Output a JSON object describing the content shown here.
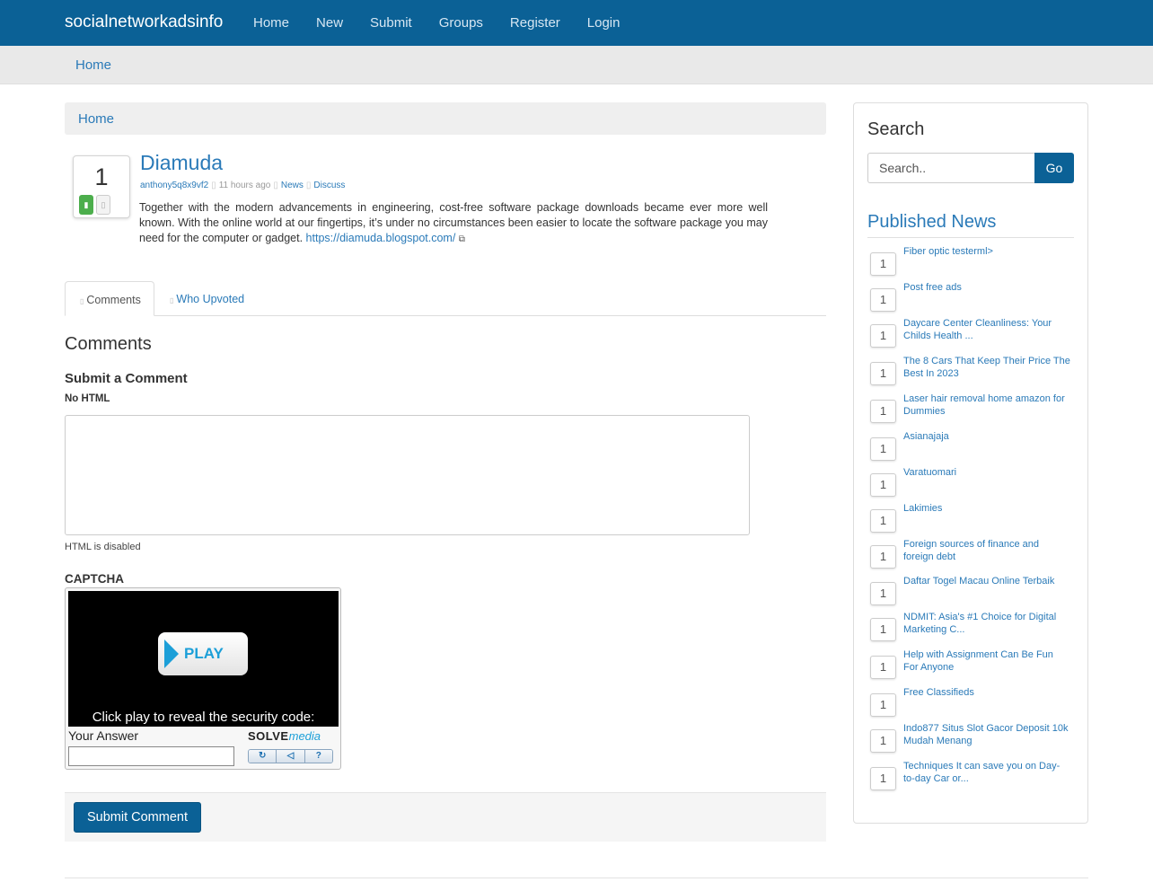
{
  "nav": {
    "brand": "socialnetworkadsinfo",
    "links": [
      "Home",
      "New",
      "Submit",
      "Groups",
      "Register",
      "Login"
    ]
  },
  "subbar": {
    "home": "Home"
  },
  "breadcrumb": {
    "home": "Home"
  },
  "post": {
    "votes": "1",
    "title": "Diamuda",
    "author": "anthony5q8x9vf2",
    "time": "11 hours ago",
    "category": "News",
    "discuss": "Discuss",
    "body": "Together with the modern advancements in engineering, cost-free software package downloads became ever more well known. With the online world at our fingertips, it’s under no circumstances been easier to locate the software package you may need for the computer or gadget.",
    "link": "https://diamuda.blogspot.com/"
  },
  "tabs": {
    "comments": "Comments",
    "upvoted": "Who Upvoted"
  },
  "comments_form": {
    "heading": "Comments",
    "submit_heading": "Submit a Comment",
    "no_html": "No HTML",
    "html_disabled": "HTML is disabled",
    "captcha_heading": "CAPTCHA",
    "captcha_play": "PLAY",
    "captcha_message": "Click play to reveal the security code:",
    "your_answer": "Your Answer",
    "solve_brand": "SOLVE",
    "solve_brand2": "media",
    "submit_button": "Submit Comment"
  },
  "sidebar": {
    "search_heading": "Search",
    "search_placeholder": "Search..",
    "go_button": "Go",
    "published_heading": "Published News",
    "news": [
      {
        "count": "1",
        "title": "Fiber optic testerml>"
      },
      {
        "count": "1",
        "title": "Post free ads"
      },
      {
        "count": "1",
        "title": "Daycare Center Cleanliness: Your Childs Health ..."
      },
      {
        "count": "1",
        "title": "The 8 Cars That Keep Their Price The Best In 2023"
      },
      {
        "count": "1",
        "title": "Laser hair removal home amazon for Dummies"
      },
      {
        "count": "1",
        "title": "Asianajaja"
      },
      {
        "count": "1",
        "title": "Varatuomari"
      },
      {
        "count": "1",
        "title": "Lakimies"
      },
      {
        "count": "1",
        "title": "Foreign sources of finance and foreign debt"
      },
      {
        "count": "1",
        "title": "Daftar Togel Macau Online Terbaik"
      },
      {
        "count": "1",
        "title": "NDMIT: Asia's #1 Choice for Digital Marketing C..."
      },
      {
        "count": "1",
        "title": "Help with Assignment Can Be Fun For Anyone"
      },
      {
        "count": "1",
        "title": "Free Classifieds"
      },
      {
        "count": "1",
        "title": "Indo877 Situs Slot Gacor Deposit 10k Mudah Menang"
      },
      {
        "count": "1",
        "title": "Techniques It can save you on Day-to-day Car or..."
      }
    ]
  }
}
